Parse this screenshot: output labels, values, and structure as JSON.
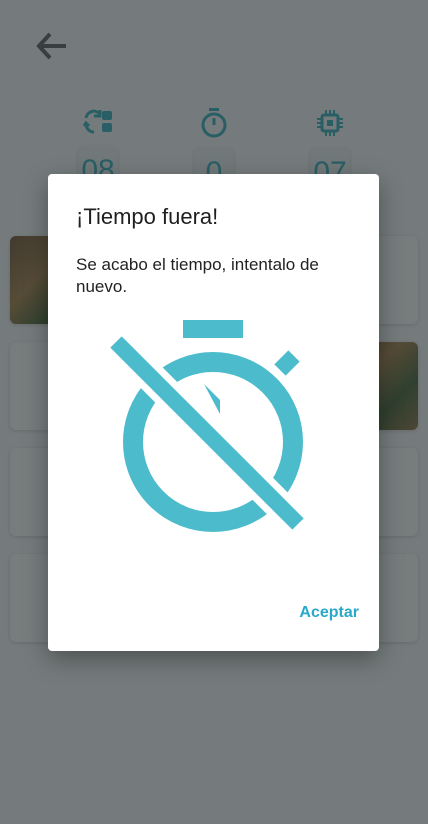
{
  "stats": [
    {
      "icon": "swap-cards-icon",
      "value": "08"
    },
    {
      "icon": "stopwatch-icon",
      "value": "0"
    },
    {
      "icon": "chip-icon",
      "value": "07"
    }
  ],
  "dialog": {
    "title": "¡Tiempo fuera!",
    "message": "Se acabo el tiempo, intentalo de nuevo.",
    "icon": "timer-off-icon",
    "accept_label": "Aceptar"
  },
  "colors": {
    "accent": "#2aa8c8",
    "icon": "#4cbccc",
    "overlay": "rgba(40,48,50,0.62)"
  }
}
